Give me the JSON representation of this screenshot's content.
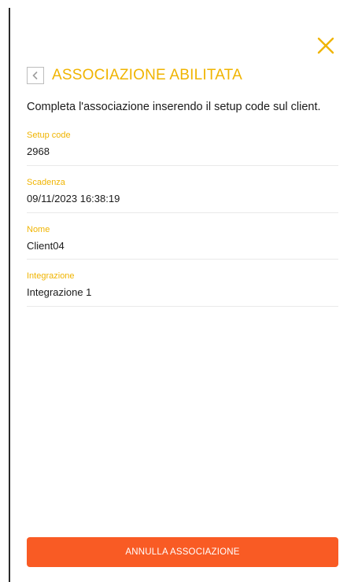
{
  "dialog": {
    "title": "ASSOCIAZIONE ABILITATA",
    "intro": "Completa l'associazione inserendo il setup code sul client."
  },
  "fields": [
    {
      "label": "Setup code",
      "value": "2968"
    },
    {
      "label": "Scadenza",
      "value": "09/11/2023 16:38:19"
    },
    {
      "label": "Nome",
      "value": "Client04"
    },
    {
      "label": "Integrazione",
      "value": "Integrazione 1"
    }
  ],
  "actions": {
    "cancel_label": "ANNULLA ASSOCIAZIONE"
  },
  "icons": {
    "close": "close-icon",
    "back": "chevron-left-icon"
  },
  "colors": {
    "accent": "#f0b400",
    "button": "#f95b24",
    "button_text": "#ffffff",
    "text": "#1a1a1a",
    "divider": "#e9e9e9"
  }
}
